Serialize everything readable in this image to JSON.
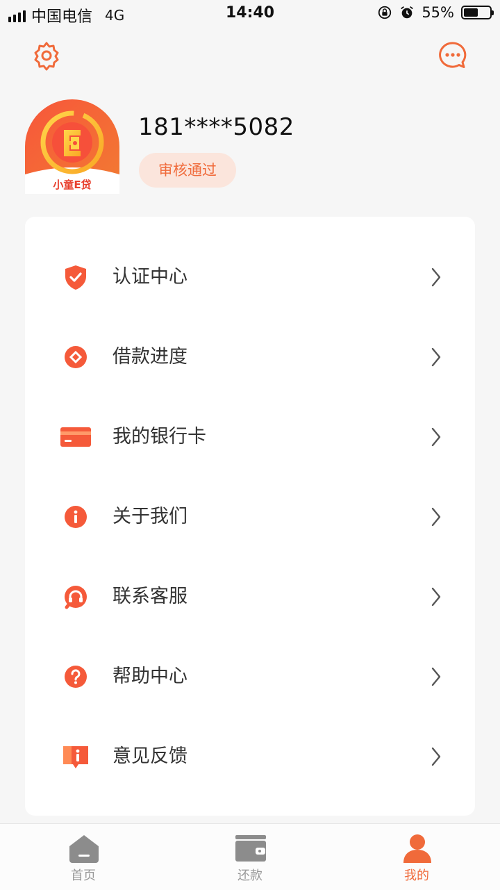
{
  "status_bar": {
    "carrier": "中国电信",
    "network": "4G",
    "time": "14:40",
    "battery": "55%",
    "battery_level": 0.55
  },
  "header": {
    "settings_icon": "gear-icon",
    "message_icon": "chat-bubble-icon"
  },
  "profile": {
    "phone": "181****5082",
    "status": "审核通过",
    "avatar_brand": "小童E贷"
  },
  "menu": {
    "items": [
      {
        "label": "认证中心",
        "icon": "shield-check-icon"
      },
      {
        "label": "借款进度",
        "icon": "progress-icon"
      },
      {
        "label": "我的银行卡",
        "icon": "bank-card-icon"
      },
      {
        "label": "关于我们",
        "icon": "info-icon"
      },
      {
        "label": "联系客服",
        "icon": "headset-icon"
      },
      {
        "label": "帮助中心",
        "icon": "question-icon"
      },
      {
        "label": "意见反馈",
        "icon": "feedback-icon"
      }
    ]
  },
  "tabs": [
    {
      "label": "首页",
      "icon": "home-icon",
      "active": false
    },
    {
      "label": "还款",
      "icon": "wallet-icon",
      "active": false
    },
    {
      "label": "我的",
      "icon": "user-icon",
      "active": true
    }
  ],
  "colors": {
    "accent": "#f06a3a",
    "badge_bg": "#fbe5dc",
    "background": "#f6f6f6",
    "inactive_tab": "#999999"
  }
}
